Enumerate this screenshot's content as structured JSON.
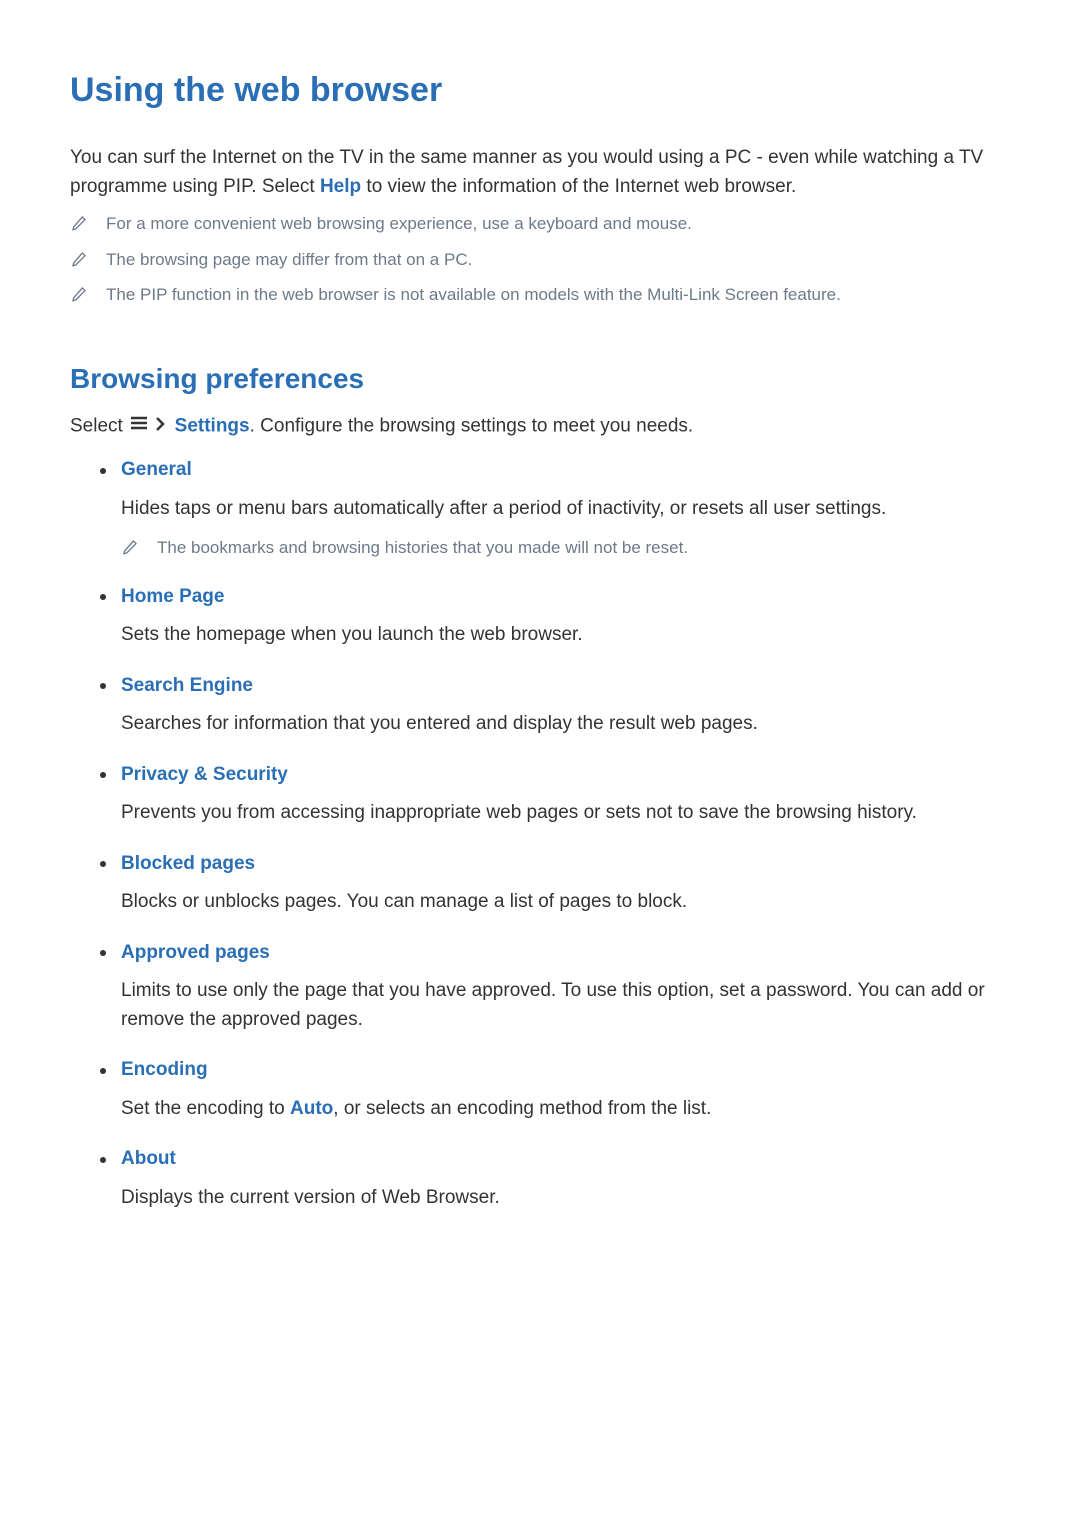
{
  "title": "Using the web browser",
  "intro_pre": "You can surf the Internet on the TV in the same manner as you would using a PC - even while watching a TV programme using PIP. Select ",
  "intro_help": "Help",
  "intro_post": " to view the information of the Internet web browser.",
  "notes": [
    "For a more convenient web browsing experience, use a keyboard and mouse.",
    "The browsing page may differ from that on a PC.",
    "The PIP function in the web browser is not available on models with the Multi-Link Screen feature."
  ],
  "section2_title": "Browsing preferences",
  "settings_pre": "Select ",
  "settings_link": "Settings",
  "settings_post": ". Configure the browsing settings to meet you needs.",
  "prefs": [
    {
      "title": "General",
      "desc": "Hides taps or menu bars automatically after a period of inactivity, or resets all user settings.",
      "note": "The bookmarks and browsing histories that you made will not be reset."
    },
    {
      "title": "Home Page",
      "desc": "Sets the homepage when you launch the web browser."
    },
    {
      "title": "Search Engine",
      "desc": "Searches for information that you entered and display the result web pages."
    },
    {
      "title": "Privacy & Security",
      "desc": "Prevents you from accessing inappropriate web pages or sets not to save the browsing history."
    },
    {
      "title": "Blocked pages",
      "desc": "Blocks or unblocks pages. You can manage a list of pages to block."
    },
    {
      "title": "Approved pages",
      "desc": "Limits to use only the page that you have approved. To use this option, set a password. You can add or remove the approved pages."
    },
    {
      "title": "Encoding",
      "desc_pre": "Set the encoding to ",
      "desc_hl": "Auto",
      "desc_post": ", or selects an encoding method from the list."
    },
    {
      "title": "About",
      "desc": "Displays the current version of Web Browser."
    }
  ]
}
